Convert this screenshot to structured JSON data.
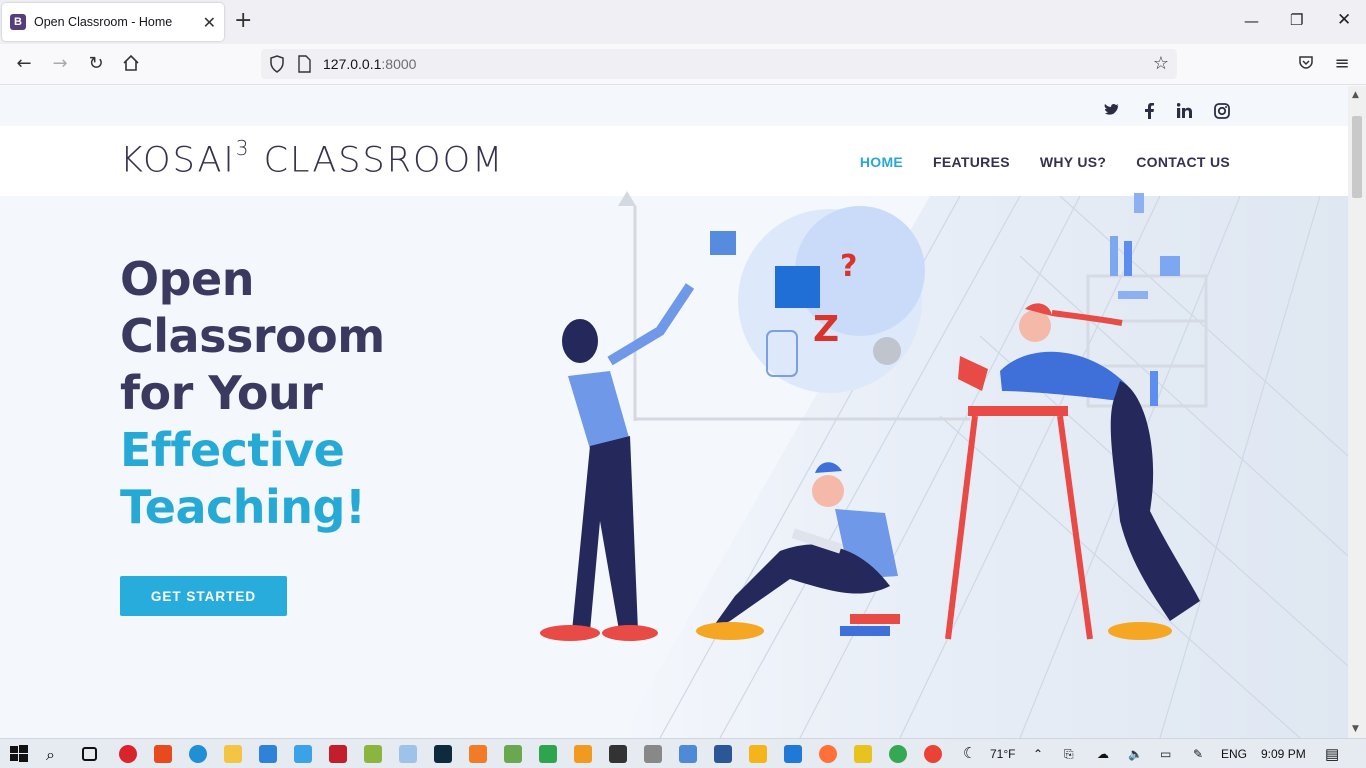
{
  "browser": {
    "tab_favicon": "B",
    "tab_title": "Open Classroom - Home",
    "url_host": "127.0.0.1",
    "url_port": ":8000"
  },
  "page": {
    "logo_main": "KOSAI",
    "logo_sup": "3",
    "logo_rest": " CLASSROOM",
    "nav": [
      {
        "label": "HOME",
        "active": true
      },
      {
        "label": "FEATURES",
        "active": false
      },
      {
        "label": "WHY US?",
        "active": false
      },
      {
        "label": "CONTACT US",
        "active": false
      }
    ],
    "social_icons": [
      "twitter-icon",
      "facebook-icon",
      "linkedin-icon",
      "instagram-icon"
    ],
    "hero_line1": "Open",
    "hero_line2": "Classroom",
    "hero_line3": "for Your",
    "hero_line4": "Effective",
    "hero_line5": "Teaching!",
    "cta_label": "GET STARTED",
    "colors": {
      "accent": "#27a9d6",
      "heading": "#3a3960",
      "button": "#27acdb"
    }
  },
  "taskbar": {
    "weather": "71°F",
    "language": "ENG",
    "time": "9:09 PM"
  }
}
